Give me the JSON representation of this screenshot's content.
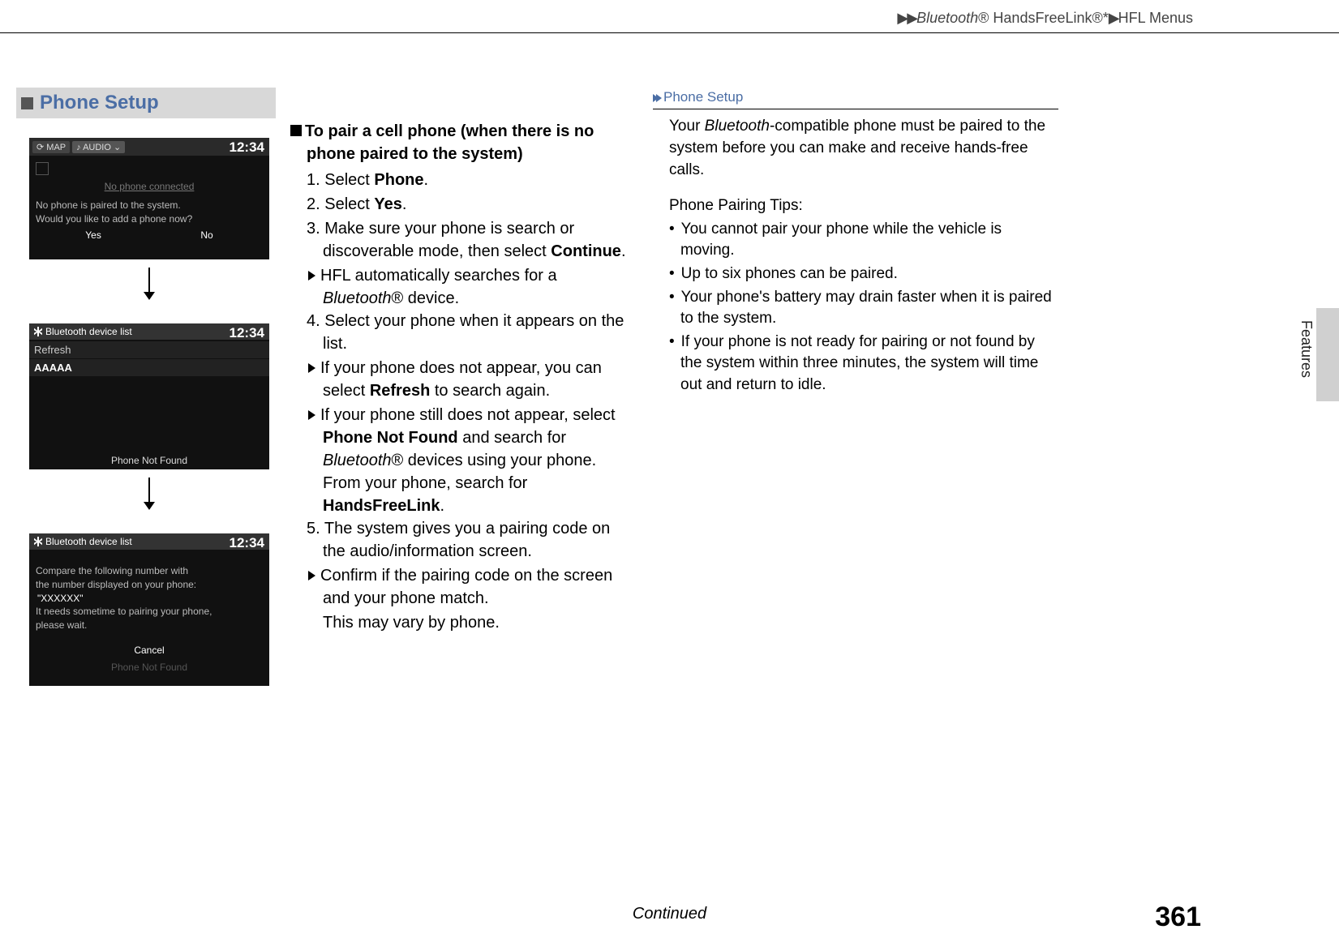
{
  "header": {
    "breadcrumb_parts": [
      "Bluetooth",
      "®",
      " HandsFreeLink",
      "®",
      "*",
      "HFL Menus"
    ]
  },
  "side_tab": "Features",
  "section_title": "Phone Setup",
  "screens": {
    "s1": {
      "map": "MAP",
      "audio": "AUDIO",
      "clock": "12:34",
      "ghost": "No phone connected",
      "line1": "No phone is paired to the system.",
      "line2": "Would you like to add a phone now?",
      "yes": "Yes",
      "no": "No"
    },
    "s2": {
      "title": "Bluetooth device list",
      "clock": "12:34",
      "row1": "Refresh",
      "row2": "AAAAA",
      "footer": "Phone Not Found"
    },
    "s3": {
      "title": "Bluetooth device list",
      "clock": "12:34",
      "l1": "Compare the following number with",
      "l2": "the number displayed on your phone:",
      "code": "\"XXXXXX\"",
      "l3": "It needs sometime to pairing your phone,",
      "l4": "please wait.",
      "cancel": "Cancel",
      "footer": "Phone Not Found"
    }
  },
  "instructions": {
    "heading": "To pair a cell phone (when there is no phone paired to the system)",
    "step1_pre": "1. Select ",
    "step1_bold": "Phone",
    "step1_post": ".",
    "step2_pre": "2. Select ",
    "step2_bold": "Yes",
    "step2_post": ".",
    "step3_pre": "3. Make sure your phone is search or discoverable mode, then select ",
    "step3_bold": "Continue",
    "step3_post": ".",
    "step3_sub1_a": "HFL automatically searches for a ",
    "step3_sub1_b": "Bluetooth",
    "step3_sub1_c": "® device.",
    "step4": "4. Select your phone when it appears on the list.",
    "step4_sub1_a": "If your phone does not appear, you can select ",
    "step4_sub1_b": "Refresh",
    "step4_sub1_c": " to search again.",
    "step4_sub2_a": "If your phone still does not appear, select ",
    "step4_sub2_b": "Phone Not Found",
    "step4_sub2_c": " and search for ",
    "step4_sub2_d": "Bluetooth",
    "step4_sub2_e": "® devices using your phone. From your phone, search for ",
    "step4_sub2_f": "HandsFreeLink",
    "step4_sub2_g": ".",
    "step5": "5. The system gives you a pairing code on the audio/information screen.",
    "step5_sub1": "Confirm if the pairing code on the screen and your phone match.",
    "step5_sub2": "This may vary by phone."
  },
  "sidebar": {
    "title": "Phone Setup",
    "para_a": "Your ",
    "para_b": "Bluetooth",
    "para_c": "-compatible phone must be paired to the system before you can make and receive hands-free calls.",
    "tips_title": "Phone Pairing Tips:",
    "tips": [
      "You cannot pair your phone while the vehicle is moving.",
      "Up to six phones can be paired.",
      "Your phone's battery may drain faster when it is paired to the system.",
      "If your phone is not ready for pairing or not found by the system within three minutes, the system will time out and return to idle."
    ]
  },
  "footer": {
    "continued": "Continued",
    "page": "361"
  }
}
